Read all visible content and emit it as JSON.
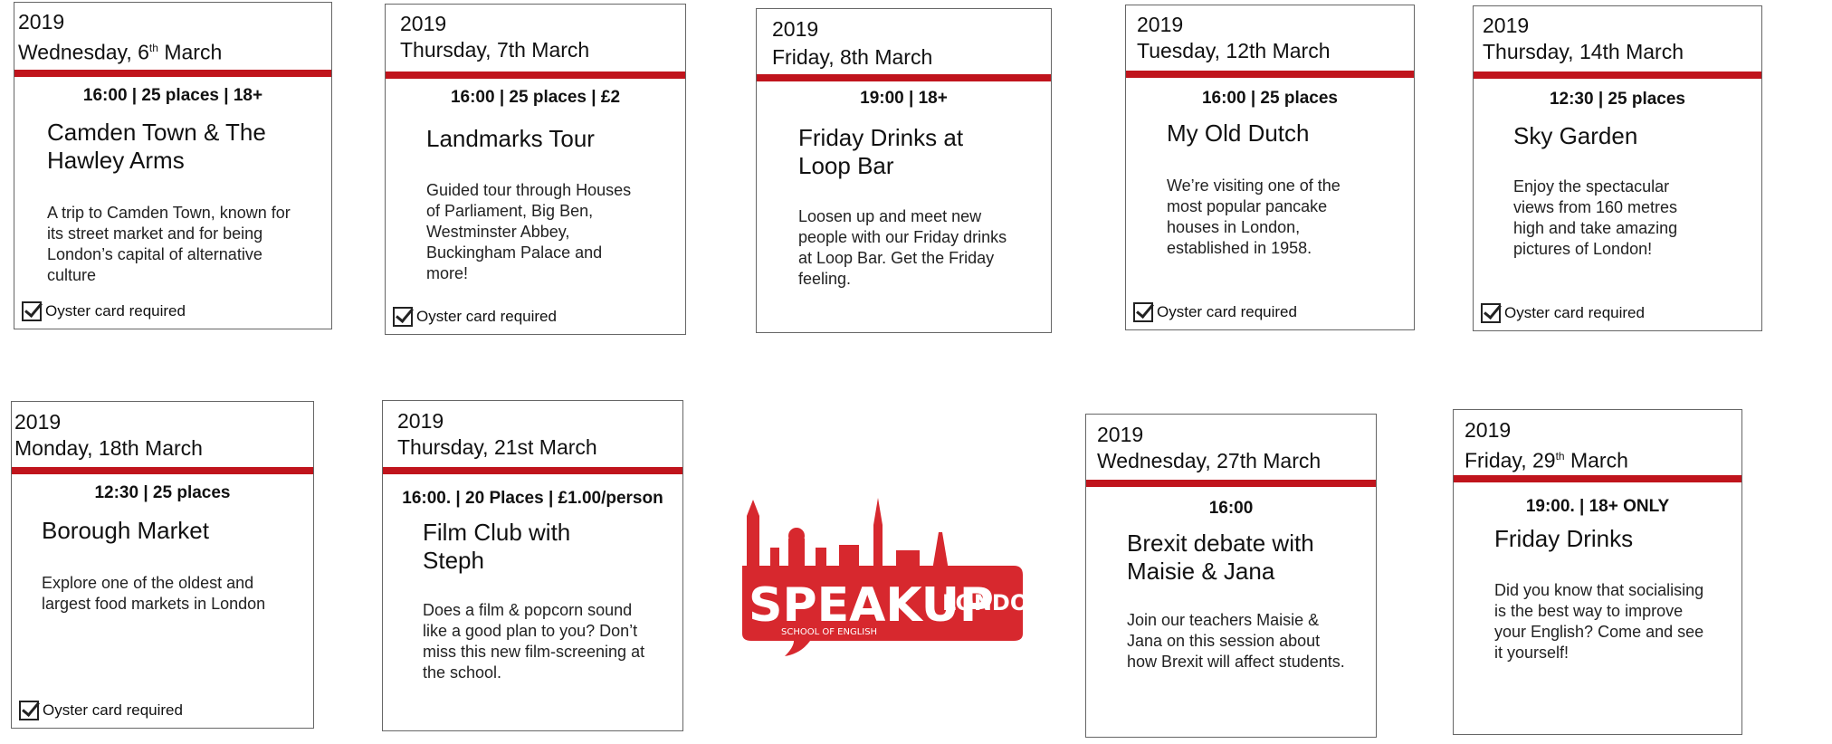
{
  "events": [
    {
      "year": "2019",
      "day": "Wednesday, 6",
      "sup": "th",
      "month": " March",
      "meta": "16:00 | 25 places | 18+",
      "title": "Camden Town & The Hawley Arms",
      "description": "A trip to Camden Town, known for its street market and for being London’s capital of alternative culture",
      "oyster": "Oyster card required"
    },
    {
      "year": "2019",
      "day": "Thursday, 7th March",
      "sup": "",
      "month": "",
      "meta": "16:00 | 25 places | £2",
      "title": "Landmarks Tour",
      "description": "Guided tour through Houses of Parliament, Big Ben, Westminster Abbey, Buckingham Palace and more!",
      "oyster": "Oyster card required"
    },
    {
      "year": "2019",
      "day": "Friday, 8th March",
      "sup": "",
      "month": "",
      "meta": "19:00 | 18+",
      "title": "Friday Drinks at Loop Bar",
      "description": "Loosen up and meet new people with our Friday drinks at Loop Bar. Get the Friday feeling.",
      "oyster": ""
    },
    {
      "year": "2019",
      "day": "Tuesday, 12th March",
      "sup": "",
      "month": "",
      "meta": "16:00 | 25 places",
      "title": "My Old Dutch",
      "description": "We’re visiting one of the most popular pancake houses in London, established in 1958.",
      "oyster": "Oyster card required"
    },
    {
      "year": "2019",
      "day": "Thursday, 14th March",
      "sup": "",
      "month": "",
      "meta": "12:30 | 25 places",
      "title": "Sky Garden",
      "description": "Enjoy the spectacular views from 160 metres high and take amazing pictures of London!",
      "oyster": "Oyster card required"
    },
    {
      "year": "2019",
      "day": "Monday, 18th  March",
      "sup": "",
      "month": "",
      "meta": "12:30 | 25 places",
      "title": "Borough Market",
      "description": "Explore one of the oldest and largest food markets in London",
      "oyster": "Oyster card required"
    },
    {
      "year": "2019",
      "day": "Thursday, 21st March",
      "sup": "",
      "month": "",
      "meta": "16:00. | 20 Places  |  £1.00/person",
      "title": "Film Club with Steph",
      "description": "Does a film & popcorn sound like a good plan to you? Don’t miss this new film-screening at the school.",
      "oyster": ""
    },
    {
      "year": "2019",
      "day": "Wednesday, 27th March",
      "sup": "",
      "month": "",
      "meta": "16:00",
      "title": "Brexit debate with Maisie & Jana",
      "description": "Join our teachers Maisie & Jana on this session about how Brexit will affect students.",
      "oyster": ""
    },
    {
      "year": "2019",
      "day": "Friday, 29",
      "sup": "th",
      "month": " March",
      "meta": "19:00. |  18+ ONLY",
      "title": "Friday Drinks",
      "description": "Did you know that socialising is the best way to improve your English? Come and see it yourself!",
      "oyster": ""
    }
  ],
  "logo": {
    "main": "SPEAKUP",
    "side": "LONDON",
    "sub": "SCHOOL OF ENGLISH",
    "color": "#d7282e"
  }
}
